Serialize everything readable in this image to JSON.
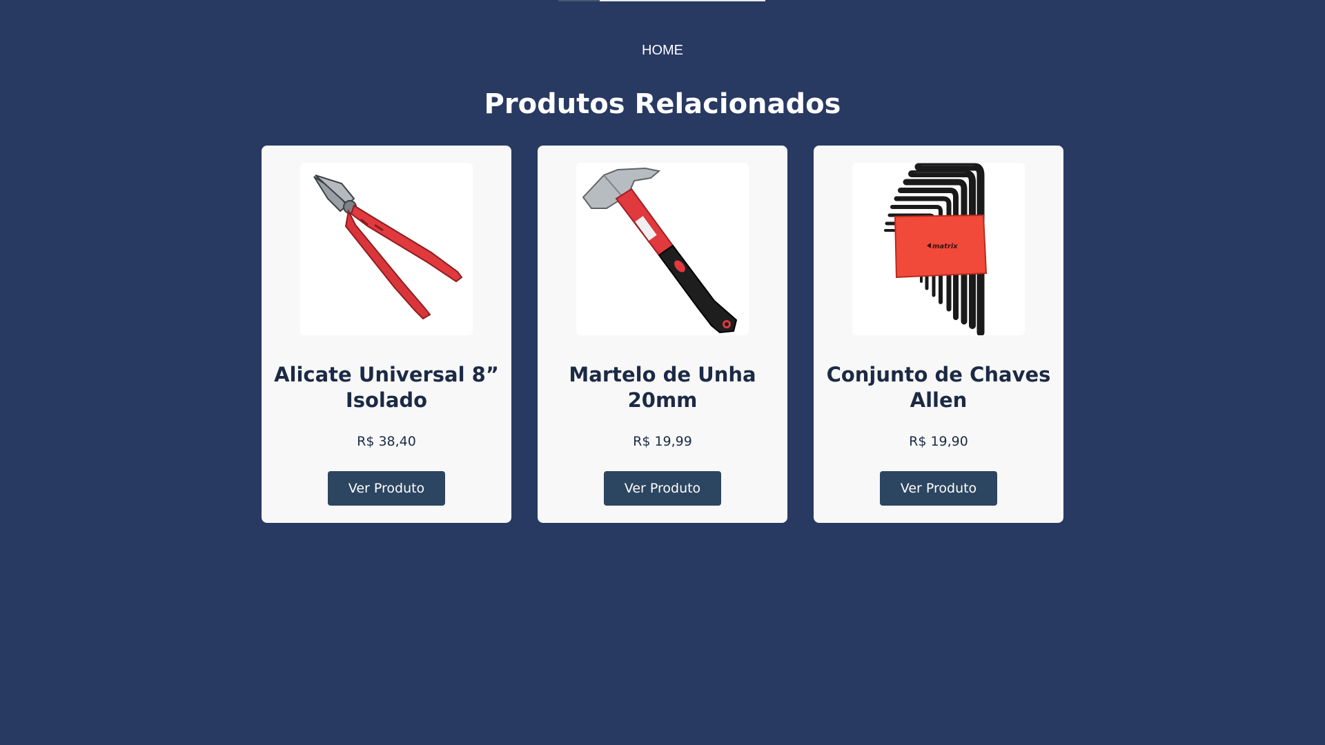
{
  "nav": {
    "home_label": "HOME"
  },
  "section": {
    "title": "Produtos Relacionados"
  },
  "products": [
    {
      "name": "Alicate Universal 8” Isolado",
      "price": "R$ 38,40",
      "button_label": "Ver Produto",
      "image_icon": "pliers-icon"
    },
    {
      "name": "Martelo de Unha 20mm",
      "price": "R$ 19,99",
      "button_label": "Ver Produto",
      "image_icon": "hammer-icon"
    },
    {
      "name": "Conjunto de Chaves Allen",
      "price": "R$ 19,90",
      "button_label": "Ver Produto",
      "image_icon": "allen-key-set-icon"
    }
  ],
  "colors": {
    "background": "#283962",
    "card_background": "#f8f8f8",
    "button_background": "#2c4560",
    "text_dark": "#1b2a45",
    "accent_red": "#e0393e"
  }
}
